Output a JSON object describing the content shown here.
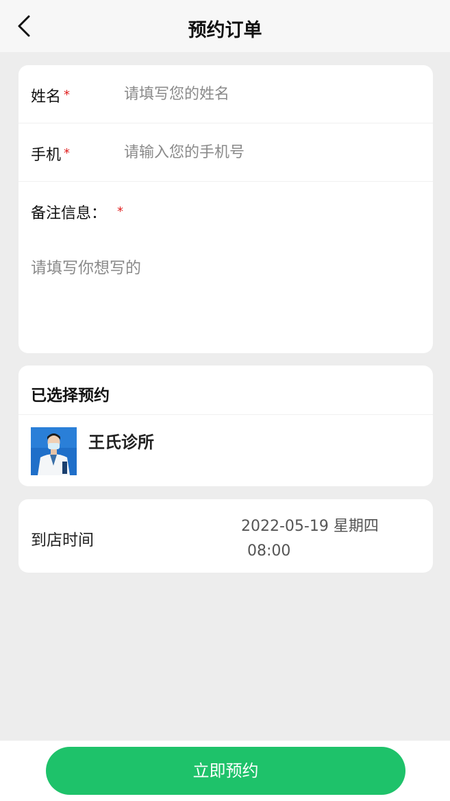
{
  "nav": {
    "title": "预约订单",
    "back_icon": "chevron-left-icon"
  },
  "form": {
    "name": {
      "label": "姓名",
      "required_mark": "*",
      "placeholder": "请填写您的姓名",
      "value": ""
    },
    "phone": {
      "label": "手机",
      "required_mark": "*",
      "placeholder": "请输入您的手机号",
      "value": ""
    },
    "note": {
      "label": "备注信息：",
      "required_mark": "*",
      "placeholder": "请填写你想写的",
      "value": ""
    }
  },
  "selected": {
    "title": "已选择预约",
    "clinic_name": "王氏诊所"
  },
  "arrival": {
    "label": "到店时间",
    "date": "2022-05-19 星期四",
    "time": "08:00"
  },
  "footer": {
    "book_button": "立即预约"
  },
  "colors": {
    "primary": "#1ec26a",
    "required": "#e02020",
    "background": "#ededed",
    "clinic_thumb": "#1f6fc9"
  }
}
